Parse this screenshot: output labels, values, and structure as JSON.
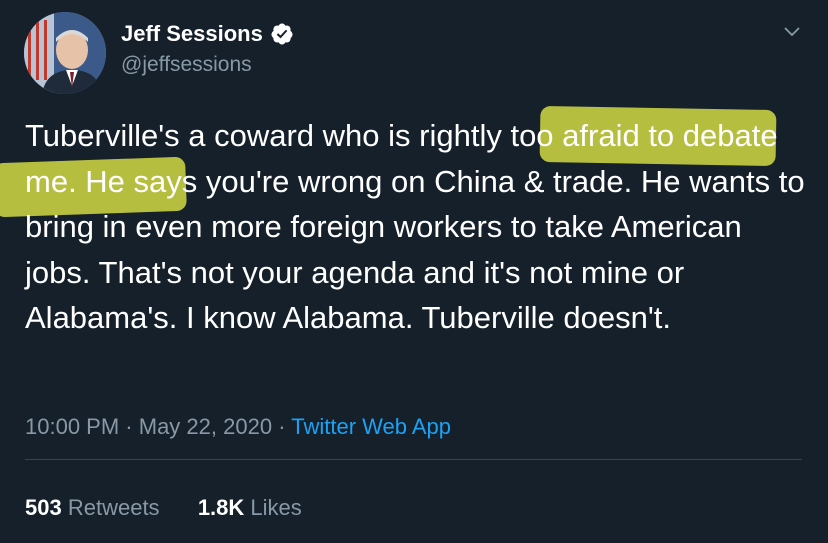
{
  "author": {
    "name": "Jeff Sessions",
    "handle": "@jeffsessions",
    "verified": true
  },
  "tweet": {
    "text_parts": [
      "Tuberville's a coward who is rightly too afraid to debate me. He says you're wrong on China & trade. He wants to bring in even more foreign workers to take American jobs. That's not your agenda and it's not mine or Alabama's. I know Alabama. Tuberville doesn't."
    ],
    "highlighted_phrase": "too afraid to debate me"
  },
  "meta": {
    "time": "10:00 PM",
    "separator": "·",
    "date": "May 22, 2020",
    "app": "Twitter Web App"
  },
  "stats": {
    "retweets_count": "503",
    "retweets_label": "Retweets",
    "likes_count": "1.8K",
    "likes_label": "Likes"
  },
  "colors": {
    "background": "#15202b",
    "text": "#ffffff",
    "secondary": "#8899a6",
    "link": "#1da1f2",
    "highlight": "#e4eb46"
  },
  "icons": {
    "verified": "verified-badge-icon",
    "menu": "chevron-down-icon"
  }
}
